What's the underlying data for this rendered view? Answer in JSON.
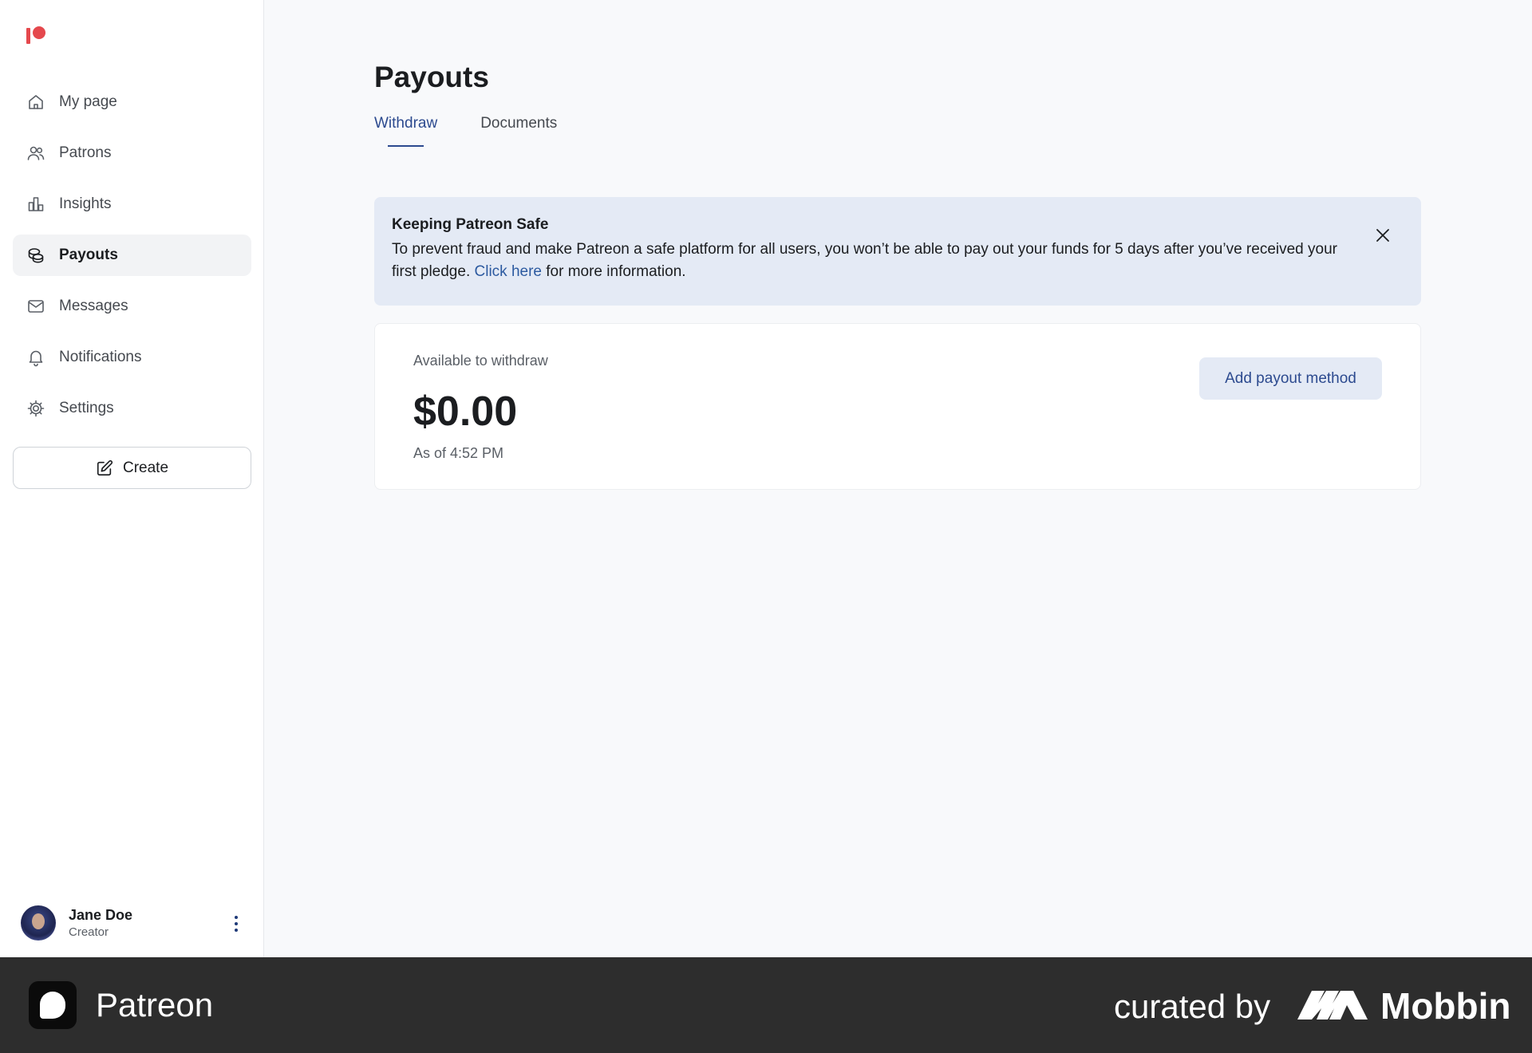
{
  "sidebar": {
    "items": [
      {
        "label": "My page",
        "icon": "home-icon",
        "active": false
      },
      {
        "label": "Patrons",
        "icon": "users-icon",
        "active": false
      },
      {
        "label": "Insights",
        "icon": "bar-chart-icon",
        "active": false
      },
      {
        "label": "Payouts",
        "icon": "coins-icon",
        "active": true
      },
      {
        "label": "Messages",
        "icon": "mail-icon",
        "active": false
      },
      {
        "label": "Notifications",
        "icon": "bell-icon",
        "active": false
      },
      {
        "label": "Settings",
        "icon": "gear-icon",
        "active": false
      }
    ],
    "create_label": "Create",
    "user": {
      "name": "Jane Doe",
      "role": "Creator"
    }
  },
  "main": {
    "title": "Payouts",
    "tabs": [
      {
        "label": "Withdraw",
        "active": true
      },
      {
        "label": "Documents",
        "active": false
      }
    ],
    "banner": {
      "title": "Keeping Patreon Safe",
      "text_before": "To prevent fraud and make Patreon a safe platform for all users, you won’t be able to pay out your funds for 5 days after you’ve received your first pledge. ",
      "link": "Click here",
      "text_after": " for more information."
    },
    "balance": {
      "label": "Available to withdraw",
      "amount": "$0.00",
      "as_of": "As of 4:52 PM",
      "button": "Add payout method"
    }
  },
  "footer": {
    "app_name": "Patreon",
    "curated_by": "curated by",
    "brand": "Mobbin"
  },
  "colors": {
    "accent": "#2c4a8f",
    "brand_red": "#e5484d",
    "banner_bg": "#e4eaf5"
  }
}
